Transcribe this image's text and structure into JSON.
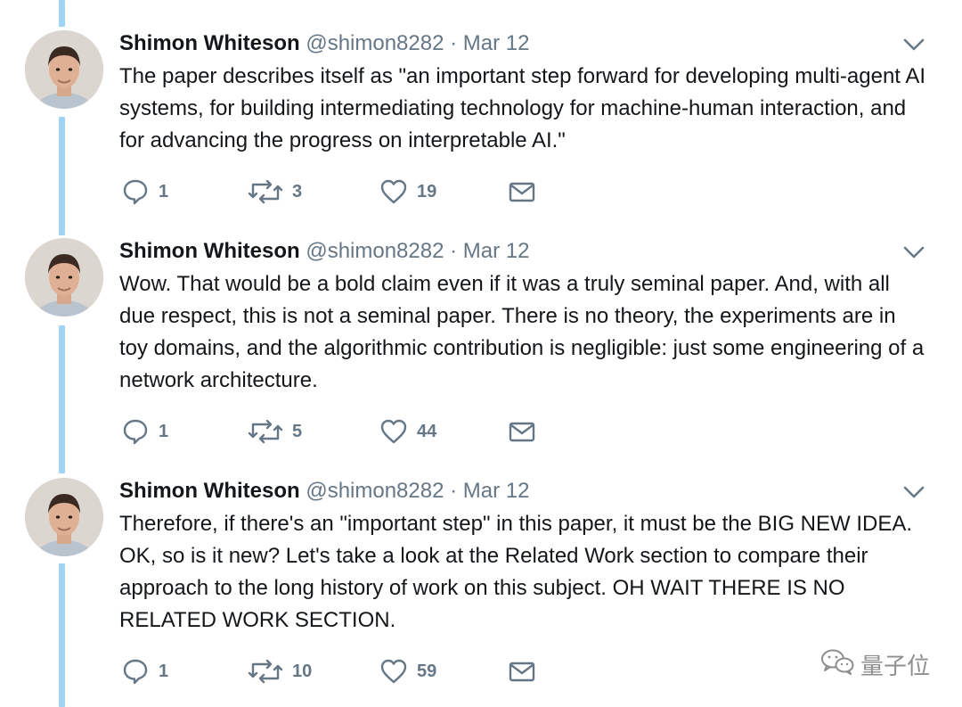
{
  "colors": {
    "thread_line": "#9fd3f3",
    "name_text": "#14171a",
    "muted_text": "#657786",
    "body_text": "#14171a",
    "watermark": "#8f8f8f"
  },
  "tweets": [
    {
      "author_name": "Shimon Whiteson",
      "handle": "@shimon8282",
      "separator": "·",
      "date": "Mar 12",
      "text": "The paper describes itself as \"an important step forward for developing multi-agent AI systems, for building intermediating technology for machine-human interaction, and for advancing the progress on interpretable AI.\"",
      "reply_count": "1",
      "retweet_count": "3",
      "like_count": "19",
      "icons": [
        "reply-icon",
        "retweet-icon",
        "heart-icon",
        "envelope-icon",
        "chevron-down-icon"
      ]
    },
    {
      "author_name": "Shimon Whiteson",
      "handle": "@shimon8282",
      "separator": "·",
      "date": "Mar 12",
      "text": "Wow. That would be a bold claim even if it was a truly seminal paper.  And, with all due respect, this is not a seminal paper. There is no theory, the experiments are in toy domains, and the algorithmic contribution is negligible: just some engineering of a network architecture.",
      "reply_count": "1",
      "retweet_count": "5",
      "like_count": "44",
      "icons": [
        "reply-icon",
        "retweet-icon",
        "heart-icon",
        "envelope-icon",
        "chevron-down-icon"
      ]
    },
    {
      "author_name": "Shimon Whiteson",
      "handle": "@shimon8282",
      "separator": "·",
      "date": "Mar 12",
      "text": "Therefore, if there's an \"important step\" in this paper, it must be the BIG NEW IDEA.  OK, so is it new?  Let's take a look at the Related Work section to compare their approach to the long history of work on this subject.  OH WAIT THERE IS NO RELATED WORK SECTION.",
      "reply_count": "1",
      "retweet_count": "10",
      "like_count": "59",
      "icons": [
        "reply-icon",
        "retweet-icon",
        "heart-icon",
        "envelope-icon",
        "chevron-down-icon"
      ]
    }
  ],
  "watermark": {
    "icon": "wechat-icon",
    "text": "量子位"
  }
}
